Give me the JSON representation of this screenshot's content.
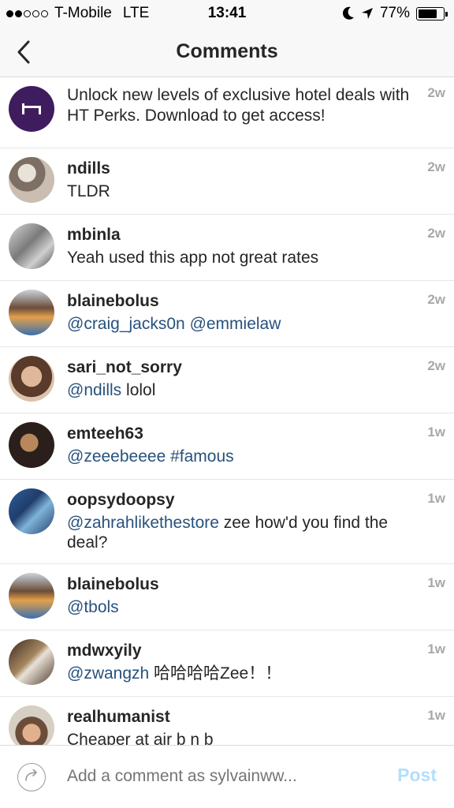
{
  "status_bar": {
    "carrier": "T-Mobile",
    "network": "LTE",
    "time": "13:41",
    "battery": "77%",
    "battery_level": 0.77
  },
  "nav": {
    "title": "Comments"
  },
  "comments": [
    {
      "username": "",
      "parts": [
        {
          "text": "Unlock new levels of exclusive hotel deals with HT Perks. Download to get access!",
          "mention": false
        }
      ],
      "time": "2w"
    },
    {
      "username": "ndills",
      "parts": [
        {
          "text": "TLDR",
          "mention": false
        }
      ],
      "time": "2w"
    },
    {
      "username": "mbinla",
      "parts": [
        {
          "text": "Yeah used this app not great rates",
          "mention": false
        }
      ],
      "time": "2w"
    },
    {
      "username": "blainebolus",
      "parts": [
        {
          "text": "@craig_jacks0n",
          "mention": true
        },
        {
          "text": " ",
          "mention": false
        },
        {
          "text": "@emmielaw",
          "mention": true
        }
      ],
      "time": "2w"
    },
    {
      "username": "sari_not_sorry",
      "parts": [
        {
          "text": "@ndills",
          "mention": true
        },
        {
          "text": " lolol",
          "mention": false
        }
      ],
      "time": "2w"
    },
    {
      "username": "emteeh63",
      "parts": [
        {
          "text": "@zeeebeeee",
          "mention": true
        },
        {
          "text": " ",
          "mention": false
        },
        {
          "text": "#famous",
          "mention": true
        }
      ],
      "time": "1w"
    },
    {
      "username": "oopsydoopsy",
      "parts": [
        {
          "text": "@zahrahlikethestore",
          "mention": true
        },
        {
          "text": " zee how'd you find the deal?",
          "mention": false
        }
      ],
      "time": "1w"
    },
    {
      "username": "blainebolus",
      "parts": [
        {
          "text": "@tbols",
          "mention": true
        }
      ],
      "time": "1w"
    },
    {
      "username": "mdwxyily",
      "parts": [
        {
          "text": "@zwangzh",
          "mention": true
        },
        {
          "text": " 哈哈哈哈Zee！！",
          "mention": false
        }
      ],
      "time": "1w"
    },
    {
      "username": "realhumanist",
      "parts": [
        {
          "text": "Cheaper at air b n b",
          "mention": false
        }
      ],
      "time": "1w"
    }
  ],
  "input": {
    "placeholder": "Add a comment as sylvainww...",
    "post_label": "Post"
  },
  "colors": {
    "mention": "#27527e",
    "ad_avatar": "#3f1c5e",
    "post_disabled": "#b2dffc"
  }
}
